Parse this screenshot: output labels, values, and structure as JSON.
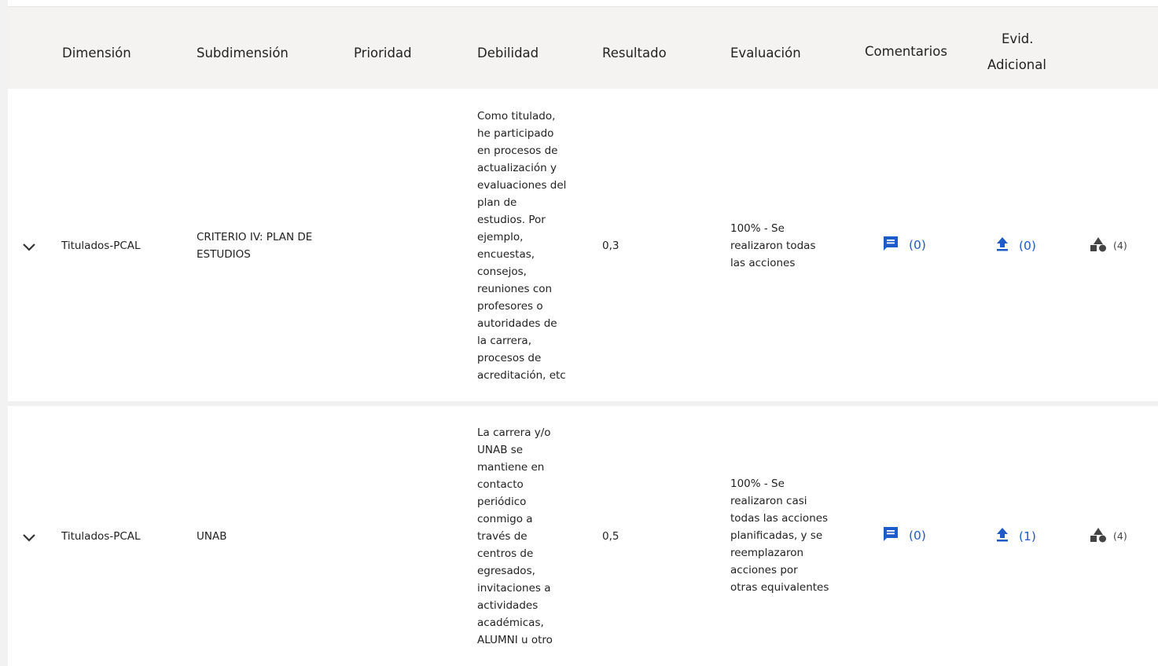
{
  "colors": {
    "accent": "#1e5bc6",
    "header_bg": "#f4f3f1",
    "row_bg": "#ffffff"
  },
  "table": {
    "headers": {
      "dimension": "Dimensión",
      "subdimension": "Subdimensión",
      "priority": "Prioridad",
      "weakness": "Debilidad",
      "result": "Resultado",
      "evaluation": "Evaluación",
      "comments": "Comentarios",
      "evidence_line1": "Evid.",
      "evidence_line2": "Adicional"
    },
    "rows": [
      {
        "dimension": "Titulados-PCAL",
        "subdimension": "CRITERIO IV: PLAN DE\nESTUDIOS",
        "priority": "",
        "weakness": "Como titulado,\nhe participado\nen procesos de\nactualización y\nevaluaciones del\nplan de\nestudios. Por\nejemplo,\nencuestas,\nconsejos,\nreuniones con\nprofesores o\nautoridades de\nla carrera,\nprocesos de\nacreditación, etc",
        "result": "0,3",
        "evaluation": "100% - Se\nrealizaron todas\nlas acciones",
        "comments_count": "(0)",
        "evidence_count": "(0)",
        "shapes_count": "(4)",
        "icons": {
          "expand": "chevron-down-icon",
          "comments": "comment-icon",
          "evidence": "upload-icon",
          "shapes": "shapes-icon"
        }
      },
      {
        "dimension": "Titulados-PCAL",
        "subdimension": "UNAB",
        "priority": "",
        "weakness": "La carrera y/o\nUNAB se\nmantiene en\ncontacto\nperiódico\nconmigo a\ntravés de\ncentros de\negresados,\ninvitaciones a\nactividades\nacadémicas,\nALUMNI u otro",
        "result": "0,5",
        "evaluation": "100% - Se\nrealizaron casi\ntodas las acciones\nplanificadas, y se\nreemplazaron\nacciones por\notras equivalentes",
        "comments_count": "(0)",
        "evidence_count": "(1)",
        "shapes_count": "(4)",
        "icons": {
          "expand": "chevron-down-icon",
          "comments": "comment-icon",
          "evidence": "upload-icon",
          "shapes": "shapes-icon"
        }
      }
    ]
  }
}
